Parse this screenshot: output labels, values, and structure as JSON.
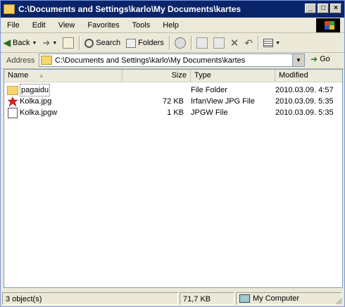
{
  "window": {
    "title": "C:\\Documents and Settings\\karlo\\My Documents\\kartes"
  },
  "titlebar_buttons": [
    "_",
    "□",
    "×"
  ],
  "menu": [
    "File",
    "Edit",
    "View",
    "Favorites",
    "Tools",
    "Help"
  ],
  "toolbar": {
    "back_label": "Back",
    "search_label": "Search",
    "folders_label": "Folders"
  },
  "address": {
    "label": "Address",
    "value": "C:\\Documents and Settings\\karlo\\My Documents\\kartes",
    "go_label": "Go"
  },
  "columns": [
    "Name",
    "Size",
    "Type",
    "Modified"
  ],
  "files": [
    {
      "name": "pagaidu",
      "size": "",
      "type": "File Folder",
      "modified": "2010.03.09. 4:57",
      "icon": "folder-icon"
    },
    {
      "name": "Kolka.jpg",
      "size": "72 KB",
      "type": "IrfanView JPG File",
      "modified": "2010.03.09. 5:35",
      "icon": "irfanview-jpg-icon"
    },
    {
      "name": "Kolka.jpgw",
      "size": "1 KB",
      "type": "JPGW File",
      "modified": "2010.03.09. 5:35",
      "icon": "generic-file-icon"
    }
  ],
  "status": {
    "objects": "3 object(s)",
    "size": "71,7 KB",
    "zone": "My Computer"
  },
  "colors": {
    "titlebar": "#0a246a",
    "window_bg": "#ece9d8",
    "column_header_bg": "#ebeadb"
  }
}
